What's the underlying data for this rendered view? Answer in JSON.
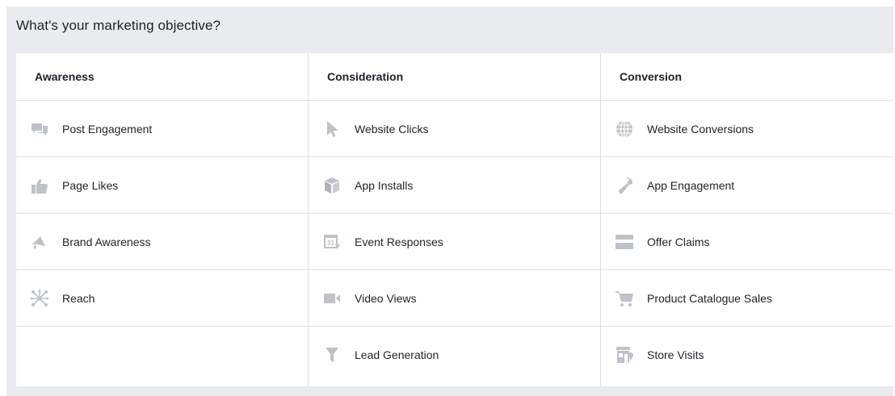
{
  "title": "What's your marketing objective?",
  "colors": {
    "panel_bg": "#e9ebee",
    "icon": "#bec2c9",
    "text": "#1d2129",
    "divider": "#dddfe2"
  },
  "columns": [
    {
      "header": "Awareness",
      "options": [
        {
          "label": "Post Engagement",
          "icon": "speech-bubbles-icon"
        },
        {
          "label": "Page Likes",
          "icon": "thumbs-up-icon"
        },
        {
          "label": "Brand Awareness",
          "icon": "megaphone-icon"
        },
        {
          "label": "Reach",
          "icon": "reach-network-icon"
        }
      ]
    },
    {
      "header": "Consideration",
      "options": [
        {
          "label": "Website Clicks",
          "icon": "cursor-icon"
        },
        {
          "label": "App Installs",
          "icon": "box-icon"
        },
        {
          "label": "Event Responses",
          "icon": "calendar-icon"
        },
        {
          "label": "Video Views",
          "icon": "video-camera-icon"
        },
        {
          "label": "Lead Generation",
          "icon": "funnel-icon"
        }
      ]
    },
    {
      "header": "Conversion",
      "options": [
        {
          "label": "Website Conversions",
          "icon": "globe-icon"
        },
        {
          "label": "App Engagement",
          "icon": "game-controller-icon"
        },
        {
          "label": "Offer Claims",
          "icon": "offer-icon"
        },
        {
          "label": "Product Catalogue Sales",
          "icon": "shopping-cart-icon"
        },
        {
          "label": "Store Visits",
          "icon": "store-icon"
        }
      ]
    }
  ]
}
